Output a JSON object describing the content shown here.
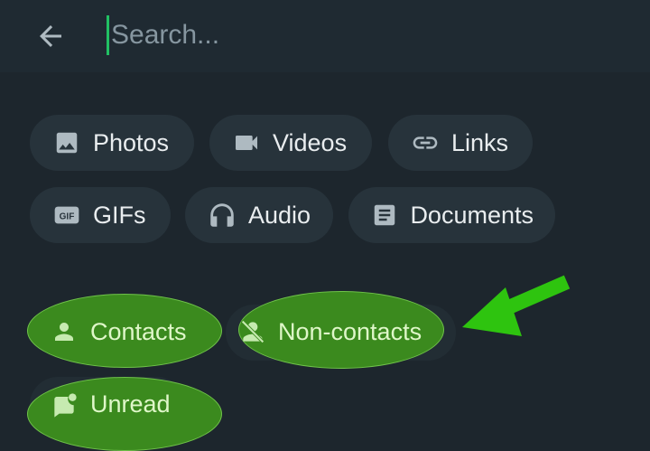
{
  "search": {
    "placeholder": "Search..."
  },
  "filters": {
    "row1": [
      {
        "label": "Photos",
        "icon": "photo-icon"
      },
      {
        "label": "Videos",
        "icon": "video-icon"
      },
      {
        "label": "Links",
        "icon": "link-icon"
      }
    ],
    "row2": [
      {
        "label": "GIFs",
        "icon": "gif-icon"
      },
      {
        "label": "Audio",
        "icon": "headphones-icon"
      },
      {
        "label": "Documents",
        "icon": "document-icon"
      }
    ],
    "row3": [
      {
        "label": "Contacts",
        "icon": "person-icon"
      },
      {
        "label": "Non-contacts",
        "icon": "person-off-icon"
      }
    ],
    "row4": [
      {
        "label": "Unread",
        "icon": "unread-icon"
      }
    ]
  },
  "colors": {
    "background": "#1d262d",
    "chip": "#27333b",
    "text": "#e9edef",
    "accent": "#21c063",
    "highlight": "#3b8a1e",
    "annotation_arrow": "#2ec40f"
  }
}
